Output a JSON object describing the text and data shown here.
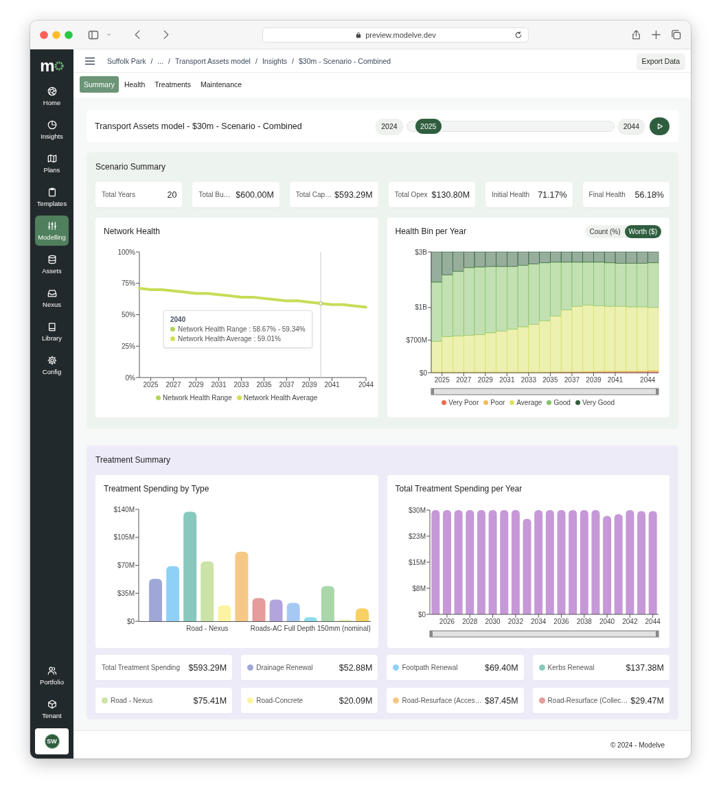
{
  "browser": {
    "url": "preview.modelve.dev"
  },
  "sidebar": {
    "logo": "m",
    "items": [
      {
        "label": "Home",
        "selected": false
      },
      {
        "label": "Insights",
        "selected": false
      },
      {
        "label": "Plans",
        "selected": false
      },
      {
        "label": "Templates",
        "selected": false
      },
      {
        "label": "Modelling",
        "selected": true
      },
      {
        "label": "Assets",
        "selected": false
      },
      {
        "label": "Nexus",
        "selected": false
      },
      {
        "label": "Library",
        "selected": false
      },
      {
        "label": "Config",
        "selected": false
      }
    ],
    "bottom_items": [
      {
        "label": "Portfolio"
      },
      {
        "label": "Tenant"
      }
    ],
    "avatar": "SW"
  },
  "breadcrumbs": [
    {
      "label": "Suffolk Park",
      "separator": "/"
    },
    {
      "label": "...",
      "separator": "/"
    },
    {
      "label": "Transport Assets model",
      "separator": "/"
    },
    {
      "label": "Insights",
      "separator": "/"
    },
    {
      "label": "$30m - Scenario - Combined"
    }
  ],
  "export_button": "Export Data",
  "tabs": [
    {
      "label": "Summary",
      "selected": true
    },
    {
      "label": "Health",
      "selected": false
    },
    {
      "label": "Treatments",
      "selected": false
    },
    {
      "label": "Maintenance",
      "selected": false
    }
  ],
  "scenario": {
    "title": "Transport Assets model - $30m - Scenario - Combined",
    "start_year": "2024",
    "current_year": "2025",
    "end_year": "2044",
    "level": 0.05
  },
  "scenario_summary": {
    "title": "Scenario Summary",
    "stats": [
      {
        "label": "Total Years",
        "value": "20"
      },
      {
        "label": "Total Bu…",
        "value": "$600.00M"
      },
      {
        "label": "Total Cap…",
        "value": "$593.29M"
      },
      {
        "label": "Total Opex",
        "value": "$130.80M"
      },
      {
        "label": "Initial Health",
        "value": "71.17%"
      },
      {
        "label": "Final Health",
        "value": "56.18%"
      }
    ],
    "network_health": {
      "title": "Network Health",
      "tooltip": {
        "title": "2040",
        "lines": [
          {
            "text": "Network Health Range : 58.67% - 59.34%",
            "color": "#b5d55a"
          },
          {
            "text": "Network Health Average : 59.01%",
            "color": "#d4e157"
          }
        ]
      },
      "legend": [
        {
          "label": "Network Health Range",
          "color": "#b5d55a"
        },
        {
          "label": "Network Health Average",
          "color": "#d4e157"
        }
      ],
      "chart_data": {
        "type": "line",
        "x": [
          2024,
          2025,
          2026,
          2027,
          2028,
          2029,
          2030,
          2031,
          2032,
          2033,
          2034,
          2035,
          2036,
          2037,
          2038,
          2039,
          2040,
          2041,
          2042,
          2043,
          2044
        ],
        "xlim": [
          2024,
          2044
        ],
        "ylim": [
          0,
          100
        ],
        "xticks": [
          2025,
          2027,
          2029,
          2031,
          2033,
          2035,
          2037,
          2039,
          2041,
          2044
        ],
        "yticks": [
          {
            "value": 0,
            "label": "0%"
          },
          {
            "value": 25,
            "label": "25%"
          },
          {
            "value": 50,
            "label": "50%"
          },
          {
            "value": 75,
            "label": "75%"
          },
          {
            "value": 100,
            "label": "100%"
          }
        ],
        "series": [
          {
            "color": "#c8dc57",
            "values": [
              71,
              70,
              70,
              69,
              68,
              67,
              67,
              66,
              65,
              64,
              64,
              63,
              62,
              61,
              61,
              60,
              59,
              58,
              58,
              57,
              56
            ]
          }
        ],
        "ref_lines": [
          {
            "axis": "x",
            "value": 2040
          }
        ]
      }
    },
    "health_bin": {
      "kind": "stacked_picture",
      "title": "Health Bin per Year",
      "toggle": [
        {
          "label": "Count (%)",
          "selected": false
        },
        {
          "label": "Worth ($)",
          "selected": true
        }
      ],
      "zoom_slider": true,
      "y_axis_labels": [
        "$3B",
        "$1B",
        "$700M",
        "$0"
      ],
      "x_axis_labels": [
        "2025",
        "2027",
        "2029",
        "2031",
        "2033",
        "2035",
        "2037",
        "2039",
        "2041",
        "2044"
      ],
      "legend": [
        {
          "label": "Very Poor",
          "color": "#ef6a4c"
        },
        {
          "label": "Poor",
          "color": "#f6bd5b"
        },
        {
          "label": "Average",
          "color": "#d9e262"
        },
        {
          "label": "Good",
          "color": "#86c266"
        },
        {
          "label": "Very Good",
          "color": "#2f5e3a"
        }
      ]
    }
  },
  "treatment_summary": {
    "title": "Treatment Summary",
    "spending_by_type": {
      "title": "Treatment Spending by Type",
      "chart_data": {
        "type": "bar",
        "ylim": [
          0,
          140
        ],
        "yticks": [
          {
            "value": 0,
            "label": "$0"
          },
          {
            "value": 35,
            "label": "$35M"
          },
          {
            "value": 70,
            "label": "$70M"
          },
          {
            "value": 105,
            "label": "$105M"
          },
          {
            "value": 140,
            "label": "$140M"
          }
        ],
        "categories": [
          null,
          null,
          null,
          "Road - Nexus",
          null,
          null,
          null,
          null,
          null,
          "Roads-AC Full Depth 150mm (nominal)",
          null,
          null,
          null
        ],
        "values": [
          53,
          69,
          137,
          75,
          20,
          87,
          29,
          27,
          23,
          5,
          44,
          2,
          16
        ],
        "colors": [
          "#9fa7d9",
          "#8fd1f6",
          "#88c9bd",
          "#cbe3a6",
          "#fbf3a1",
          "#f6c886",
          "#e59c9b",
          "#b2a4dd",
          "#a6c9f4",
          "#89dcea",
          "#a9d7a9",
          "#e6efb0",
          "#f7d163"
        ]
      }
    },
    "spending_per_year": {
      "title": "Total Treatment Spending per Year",
      "zoom_slider": true,
      "chart_data": {
        "type": "bar",
        "x": [
          2025,
          2026,
          2027,
          2028,
          2029,
          2030,
          2031,
          2032,
          2033,
          2034,
          2035,
          2036,
          2037,
          2038,
          2039,
          2040,
          2041,
          2042,
          2043,
          2044
        ],
        "xlim": [
          2024.5,
          2044.5
        ],
        "ylim": [
          0,
          30
        ],
        "xticks": [
          2026,
          2028,
          2030,
          2032,
          2034,
          2036,
          2038,
          2040,
          2042,
          2044
        ],
        "yticks": [
          {
            "value": 0,
            "label": "$0"
          },
          {
            "value": 7.5,
            "label": "$8M"
          },
          {
            "value": 15,
            "label": "$15M"
          },
          {
            "value": 22.5,
            "label": "$23M"
          },
          {
            "value": 30,
            "label": "$30M"
          }
        ],
        "series": [
          {
            "color": "#c698d8",
            "values": [
              30,
              30,
              30,
              30,
              30,
              30,
              30,
              30,
              27.5,
              30,
              30,
              30,
              30,
              30,
              30,
              28.3,
              28.8,
              30,
              29.7,
              29.7
            ]
          }
        ]
      }
    },
    "cards": [
      {
        "label": "Total Treatment Spending",
        "value": "$593.29M"
      },
      {
        "label": "Drainage Renewal",
        "value": "$52.88M",
        "color": "#9fa7d9"
      },
      {
        "label": "Footpath Renewal",
        "value": "$69.40M",
        "color": "#8fd1f6"
      },
      {
        "label": "Kerbs Renewal",
        "value": "$137.38M",
        "color": "#88c9bd"
      },
      {
        "label": "Road - Nexus",
        "value": "$75.41M",
        "color": "#cbe3a6"
      },
      {
        "label": "Road-Concrete",
        "value": "$20.09M",
        "color": "#fbf3a1"
      },
      {
        "label": "Road-Resurface (Acces…",
        "value": "$87.45M",
        "color": "#f6c886"
      },
      {
        "label": "Road-Resurface (Collec…",
        "value": "$29.47M",
        "color": "#e59c9b"
      }
    ]
  },
  "footer": "© 2024 - Modelve"
}
